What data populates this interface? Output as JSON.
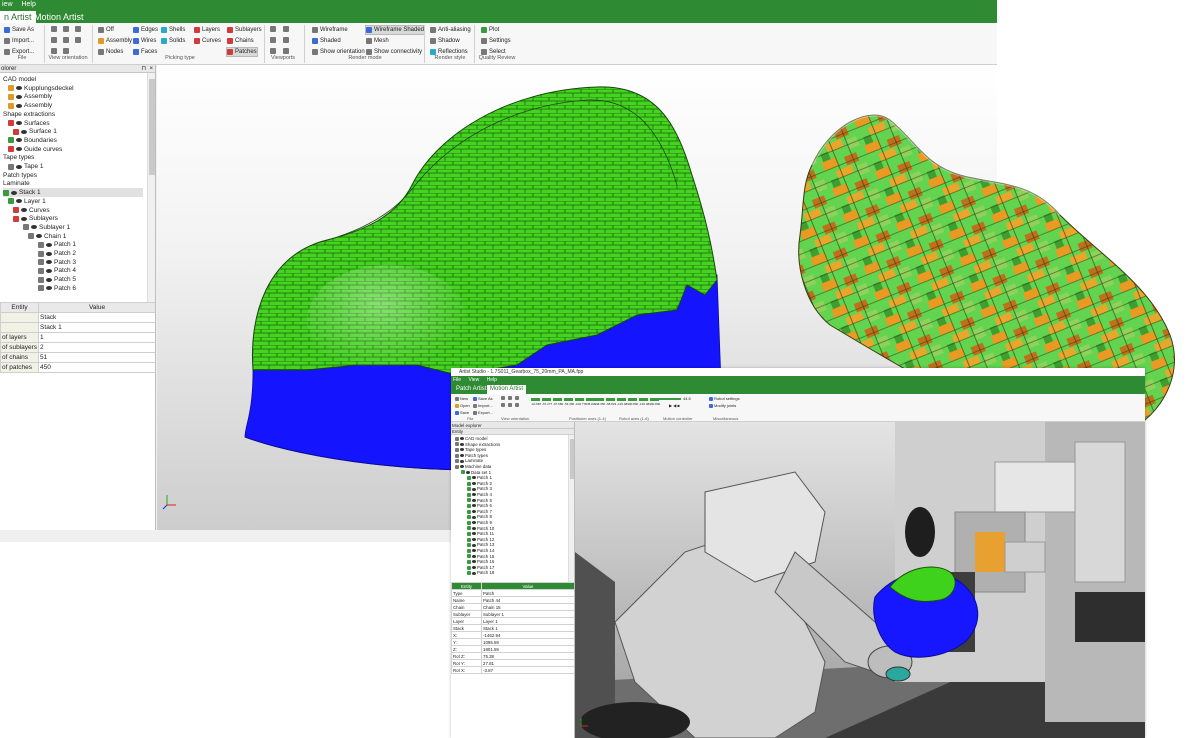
{
  "main": {
    "menu": [
      "iew",
      "Help"
    ],
    "tabs": [
      "n Artist",
      "Motion Artist"
    ],
    "ribbon": {
      "file": [
        "Save As",
        "Import...",
        "Export..."
      ],
      "picking": [
        "Off",
        "Assembly",
        "Nodes",
        "Edges",
        "Wires",
        "Faces",
        "Shells",
        "Solids",
        "Layers",
        "Curves",
        "Sublayers",
        "Chains",
        "Patches"
      ],
      "render_mode": [
        "Wireframe",
        "Shaded",
        "Show orientation",
        "Wireframe Shaded",
        "Mesh",
        "Show connectivity"
      ],
      "render_style": [
        "Anti-aliasing",
        "Shadow",
        "Reflections"
      ],
      "quality": [
        "Plot",
        "Settings",
        "Select"
      ],
      "groups": [
        "File",
        "View orientation",
        "Picking type",
        "Viewports",
        "Render mode",
        "Render style",
        "Quality Review"
      ]
    },
    "explorer": {
      "title": "olorer",
      "rows": [
        "CAD model",
        "Kupplungsdeckel",
        "Assembly",
        "Assembly",
        "Shape extractions",
        "Surfaces",
        "Surface 1",
        "Boundaries",
        "Guide curves",
        "Tape types",
        "Tape 1",
        "Patch types",
        "Laminate",
        "Stack 1",
        "Layer 1",
        "Curves",
        "Sublayers",
        "Sublayer 1",
        "Chain 1",
        "Patch 1",
        "Patch 2",
        "Patch 3",
        "Patch 4",
        "Patch 5",
        "Patch 6"
      ]
    },
    "props": {
      "headers": [
        "Entity",
        "Value"
      ],
      "rows": [
        {
          "k": "",
          "v": "Stack"
        },
        {
          "k": "",
          "v": "Stack 1"
        },
        {
          "k": "of layers",
          "v": "1"
        },
        {
          "k": "of sublayers",
          "v": "2"
        },
        {
          "k": "of chains",
          "v": "51"
        },
        {
          "k": "of patches",
          "v": "450"
        }
      ]
    }
  },
  "second": {
    "title": "Artist Studio - 1.7S011_Gearbox_75_20mm_PA_MA.fpp",
    "menu": [
      "File",
      "View",
      "Help"
    ],
    "tabs": [
      "Patch Artist",
      "Motion Artist"
    ],
    "ribbon": {
      "file": [
        "New",
        "Open",
        "Save",
        "Save As",
        "Import...",
        "Export..."
      ],
      "groups": [
        "File",
        "View orientation",
        "Positioner axes (1-4)",
        "Robot axes (1-6)",
        "Motion controller",
        "Miscellaneous"
      ],
      "misc": [
        "Robot settings",
        "Modify joints"
      ],
      "positioner_axes": [
        "-10.987",
        "-67.277",
        "-97.680",
        "-53.396",
        "-100.778",
        "-45.000"
      ],
      "robot_axes": [
        "-48.350",
        "-68.823",
        "-120.483",
        "-90.800",
        "-120.483",
        "-90.800"
      ],
      "motion_value": "44.5"
    },
    "explorer": {
      "title": "Model explorer",
      "col": "Entity",
      "rows": [
        "CAD model",
        "Shape extractions",
        "Tape types",
        "Patch types",
        "Laminate",
        "Machine data",
        "Data set 1",
        "Patch 1",
        "Patch 2",
        "Patch 3",
        "Patch 4",
        "Patch 5",
        "Patch 6",
        "Patch 7",
        "Patch 8",
        "Patch 9",
        "Patch 10",
        "Patch 11",
        "Patch 12",
        "Patch 13",
        "Patch 14",
        "Patch 15",
        "Patch 16",
        "Patch 17",
        "Patch 18"
      ]
    },
    "props": {
      "headers": [
        "Entity",
        "Value"
      ],
      "rows": [
        {
          "k": "Type",
          "v": "Patch"
        },
        {
          "k": "Name",
          "v": "Patch 44"
        },
        {
          "k": "Chain",
          "v": "Chain 15"
        },
        {
          "k": "Sublayer",
          "v": "Sublayer 1"
        },
        {
          "k": "Layer",
          "v": "Layer 1"
        },
        {
          "k": "Stack",
          "v": "Stack 1"
        },
        {
          "k": "X:",
          "v": "-1462.94"
        },
        {
          "k": "Y:",
          "v": "1095.59"
        },
        {
          "k": "Z:",
          "v": "1801.59"
        },
        {
          "k": "Rot Z:",
          "v": "75.38"
        },
        {
          "k": "Rot Y:",
          "v": "27.81"
        },
        {
          "k": "Rot X:",
          "v": "-3.87"
        }
      ]
    }
  },
  "colors": {
    "accent": "#2f8a34",
    "patch_green": "#3fd21c",
    "tool_blue": "#1616ff",
    "patch_orange": "#e89a22"
  }
}
